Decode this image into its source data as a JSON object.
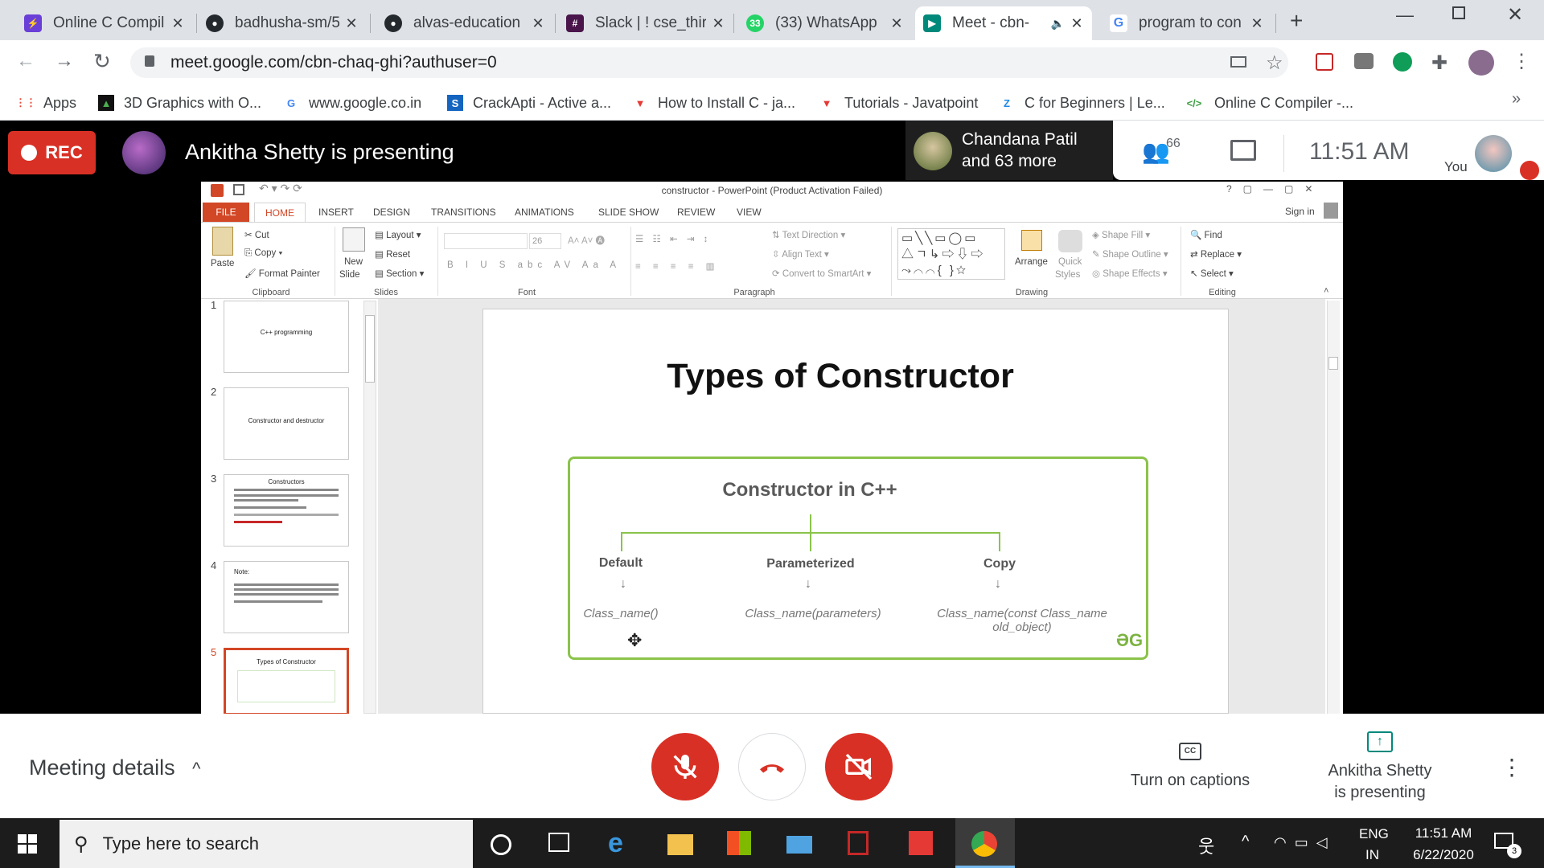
{
  "tabs": [
    {
      "title": "Online C Compil",
      "fav_color": "#6a3fd8",
      "fav_glyph": "⚡",
      "icon": "bolt-icon"
    },
    {
      "title": "badhusha-sm/5",
      "fav_color": "#24292e",
      "fav_glyph": "●",
      "icon": "github-icon"
    },
    {
      "title": "alvas-education",
      "fav_color": "#24292e",
      "fav_glyph": "●",
      "icon": "github-icon"
    },
    {
      "title": "Slack | ! cse_thir",
      "fav_color": "#4a154b",
      "fav_glyph": "#",
      "icon": "slack-icon"
    },
    {
      "title": "(33) WhatsApp",
      "fav_color": "#25d366",
      "fav_glyph": "33",
      "icon": "whatsapp-icon"
    },
    {
      "title": "Meet - cbn-",
      "fav_color": "#00897b",
      "fav_glyph": "▶",
      "icon": "meet-icon"
    },
    {
      "title": "program to con",
      "fav_color": "#ffffff",
      "fav_glyph": "G",
      "icon": "google-icon"
    }
  ],
  "address": {
    "url": "meet.google.com/cbn-chaq-ghi?authuser=0"
  },
  "bookmarks": [
    {
      "label": "Apps",
      "color": "#ea4335",
      "glyph": "⋮⋮"
    },
    {
      "label": "3D Graphics with O...",
      "color": "#111",
      "glyph": "▲"
    },
    {
      "label": "www.google.co.in",
      "color": "#4285f4",
      "glyph": "G"
    },
    {
      "label": "CrackApti - Active a...",
      "color": "#1565c0",
      "glyph": "S"
    },
    {
      "label": "How to Install C - ja...",
      "color": "#e53935",
      "glyph": "▼"
    },
    {
      "label": "Tutorials - Javatpoint",
      "color": "#e53935",
      "glyph": "▼"
    },
    {
      "label": "C for Beginners | Le...",
      "color": "#1e88e5",
      "glyph": "Z"
    },
    {
      "label": "Online C Compiler -...",
      "color": "#43a047",
      "glyph": "</>"
    }
  ],
  "meet": {
    "rec_label": "REC",
    "presenter_banner": "Ankitha Shetty is presenting",
    "participant_name": "Chandana Patil",
    "participant_more": "and 63 more",
    "participant_count": "66",
    "time": "11:51  AM",
    "self_label": "You",
    "meeting_details": "Meeting details",
    "captions_label": "Turn on captions",
    "present_label_1": "Ankitha Shetty",
    "present_label_2": "is presenting"
  },
  "ppt": {
    "title_bar": "constructor - PowerPoint (Product Activation Failed)",
    "sign_in": "Sign in",
    "menu": [
      "FILE",
      "HOME",
      "INSERT",
      "DESIGN",
      "TRANSITIONS",
      "ANIMATIONS",
      "SLIDE SHOW",
      "REVIEW",
      "VIEW"
    ],
    "clipboard": {
      "paste": "Paste",
      "cut": "Cut",
      "copy": "Copy",
      "format_painter": "Format Painter",
      "group": "Clipboard"
    },
    "slides": {
      "new_slide": "New",
      "new_slide2": "Slide",
      "layout": "Layout",
      "reset": "Reset",
      "section": "Section",
      "group": "Slides"
    },
    "font": {
      "size": "26",
      "group": "Font"
    },
    "paragraph": {
      "text_direction": "Text Direction",
      "align_text": "Align Text",
      "convert": "Convert to SmartArt",
      "group": "Paragraph"
    },
    "drawing": {
      "arrange": "Arrange",
      "quick": "Quick",
      "styles": "Styles",
      "shape_fill": "Shape Fill",
      "shape_outline": "Shape Outline",
      "shape_effects": "Shape Effects",
      "group": "Drawing"
    },
    "editing": {
      "find": "Find",
      "replace": "Replace",
      "select": "Select",
      "group": "Editing"
    },
    "thumbs": [
      {
        "num": "1",
        "title": "C++ programming"
      },
      {
        "num": "2",
        "title": "Constructor and destructor"
      },
      {
        "num": "3",
        "title": "Constructors"
      },
      {
        "num": "4",
        "title": "Note:"
      },
      {
        "num": "5",
        "title": "Types of Constructor"
      }
    ],
    "slide": {
      "title": "Types of Constructor",
      "diagram_title": "Constructor in C++",
      "types": [
        {
          "name": "Default",
          "syntax": "Class_name()"
        },
        {
          "name": "Parameterized",
          "syntax": "Class_name(parameters)"
        },
        {
          "name": "Copy",
          "syntax": "Class_name(const Class_name old_object)"
        }
      ],
      "logo": "ƏG"
    }
  },
  "taskbar": {
    "search_placeholder": "Type here to search",
    "lang1": "ENG",
    "lang2": "IN",
    "time": "11:51 AM",
    "date": "6/22/2020",
    "notif": "3"
  }
}
